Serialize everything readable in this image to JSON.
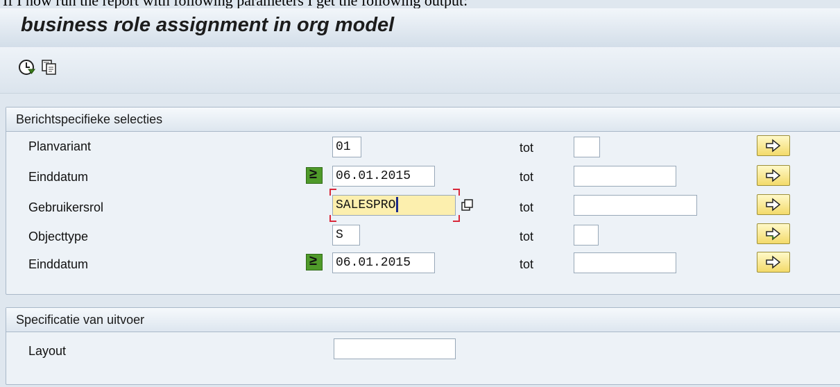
{
  "caption": "If I now run the report with following parameters I get the following output:",
  "window": {
    "title": "business role assignment in org model"
  },
  "toolbar": {
    "icons": [
      "execute-clock-icon",
      "copy-variant-icon"
    ]
  },
  "selections": {
    "title": "Berichtspecifieke selecties",
    "rows": [
      {
        "label": "Planvariant",
        "value": "01",
        "to_label": "tot",
        "to_value": "",
        "has_option": false
      },
      {
        "label": "Einddatum",
        "value": "06.01.2015",
        "to_label": "tot",
        "to_value": "",
        "has_option": true,
        "option": "≥"
      },
      {
        "label": "Gebruikersrol",
        "value": "SALESPRO",
        "to_label": "tot",
        "to_value": "",
        "has_option": false,
        "active": true
      },
      {
        "label": "Objecttype",
        "value": "S",
        "to_label": "tot",
        "to_value": "",
        "has_option": false,
        "multi_filled": true
      },
      {
        "label": "Einddatum",
        "value": "06.01.2015",
        "to_label": "tot",
        "to_value": "",
        "has_option": true,
        "option": "≥"
      }
    ]
  },
  "output": {
    "title": "Specificatie van uitvoer",
    "layout_label": "Layout",
    "layout_value": ""
  },
  "colors": {
    "option_green": "#4f9a2a",
    "active_field": "#fcefae",
    "multi_button": "#f3da6a"
  }
}
